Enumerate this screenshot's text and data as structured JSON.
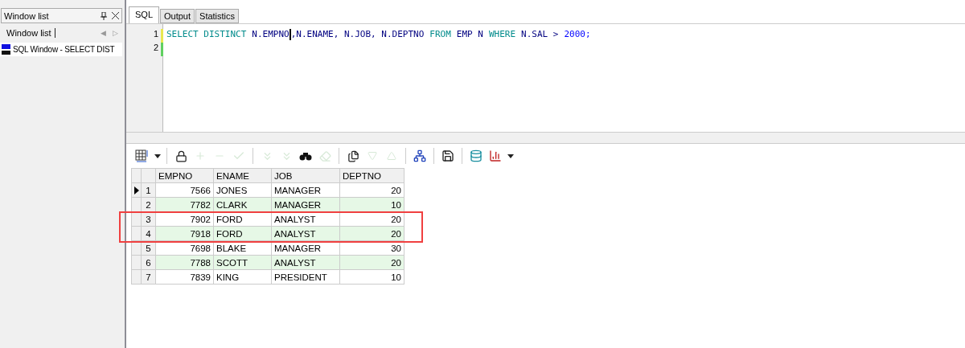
{
  "window_list": {
    "title": "Window list",
    "tab": "Window list",
    "prev": "◀",
    "next": "▷",
    "items": [
      {
        "label": "SQL Window - SELECT DIST",
        "selected": false
      }
    ]
  },
  "tabs": [
    {
      "label": "SQL",
      "selected": true
    },
    {
      "label": "Output",
      "selected": false
    },
    {
      "label": "Statistics",
      "selected": false
    }
  ],
  "editor": {
    "lines": [
      {
        "number": "1",
        "tokens": [
          {
            "kind": "keyword",
            "text": "SELECT DISTINCT"
          },
          {
            "kind": "ident",
            "text": "N.EMPNO"
          },
          {
            "kind": "cursor"
          },
          {
            "kind": "ident",
            "text": ",N.ENAME, N.JOB, N.DEPTNO"
          },
          {
            "kind": "keyword",
            "text": "FROM"
          },
          {
            "kind": "ident",
            "text": "EMP N"
          },
          {
            "kind": "keyword",
            "text": "WHERE"
          },
          {
            "kind": "ident",
            "text": "N.SAL >"
          },
          {
            "kind": "number",
            "text": "2000;"
          }
        ]
      },
      {
        "number": "2"
      }
    ]
  },
  "toolbar": [
    {
      "kind": "grid",
      "disabled": false
    },
    {
      "kind": "caret",
      "disabled": false
    },
    {
      "kind": "sep"
    },
    {
      "kind": "lock",
      "disabled": false
    },
    {
      "kind": "plus",
      "disabled": true
    },
    {
      "kind": "minus",
      "disabled": true
    },
    {
      "kind": "check",
      "disabled": true
    },
    {
      "kind": "sep"
    },
    {
      "kind": "fetch",
      "disabled": true
    },
    {
      "kind": "fetch-all",
      "disabled": true
    },
    {
      "kind": "find",
      "disabled": false
    },
    {
      "kind": "clear",
      "disabled": true
    },
    {
      "kind": "sep"
    },
    {
      "kind": "import",
      "disabled": false
    },
    {
      "kind": "down",
      "disabled": true
    },
    {
      "kind": "up",
      "disabled": true
    },
    {
      "kind": "sep"
    },
    {
      "kind": "tree",
      "disabled": false
    },
    {
      "kind": "sep"
    },
    {
      "kind": "save",
      "disabled": false
    },
    {
      "kind": "sep"
    },
    {
      "kind": "database",
      "disabled": false
    },
    {
      "kind": "chart",
      "disabled": false
    },
    {
      "kind": "caret",
      "disabled": false
    }
  ],
  "table": {
    "columns": [
      "EMPNO",
      "ENAME",
      "JOB",
      "DEPTNO"
    ],
    "rows": [
      {
        "number": "1",
        "selected": true,
        "cells": [
          "7566",
          "JONES",
          "MANAGER",
          "20"
        ]
      },
      {
        "number": "2",
        "selected": false,
        "cells": [
          "7782",
          "CLARK",
          "MANAGER",
          "10"
        ]
      },
      {
        "number": "3",
        "selected": false,
        "cells": [
          "7902",
          "FORD",
          "ANALYST",
          "20"
        ]
      },
      {
        "number": "4",
        "selected": false,
        "cells": [
          "7918",
          "FORD",
          "ANALYST",
          "20"
        ]
      },
      {
        "number": "5",
        "selected": false,
        "cells": [
          "7698",
          "BLAKE",
          "MANAGER",
          "30"
        ]
      },
      {
        "number": "6",
        "selected": false,
        "cells": [
          "7788",
          "SCOTT",
          "ANALYST",
          "20"
        ]
      },
      {
        "number": "7",
        "selected": false,
        "cells": [
          "7839",
          "KING",
          "PRESIDENT",
          "10"
        ]
      }
    ]
  }
}
